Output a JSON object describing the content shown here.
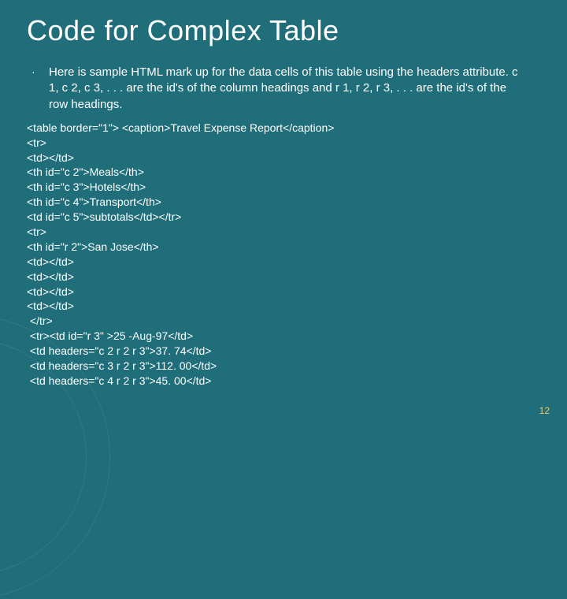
{
  "title": "Code for Complex Table",
  "bullet": {
    "marker": "·",
    "text": "Here is sample HTML mark up for the data cells of this table using the headers attribute. c 1, c 2, c 3, . . . are the id's of the column headings and r 1, r 2, r 3, . . . are the id's of the row headings."
  },
  "code_lines": [
    "<table border=\"1\"> <caption>Travel Expense Report</caption>",
    "<tr>",
    "<td></td>",
    "<th id=\"c 2\">Meals</th>",
    "<th id=\"c 3\">Hotels</th>",
    "<th id=\"c 4\">Transport</th>",
    "<td id=\"c 5\">subtotals</td></tr>",
    "<tr>",
    "<th id=\"r 2\">San Jose</th>",
    "<td></td>",
    "<td></td>",
    "<td></td>",
    "<td></td>",
    " </tr>",
    " <tr><td id=\"r 3\" >25 -Aug-97</td>",
    " <td headers=\"c 2 r 2 r 3\">37. 74</td>",
    " <td headers=\"c 3 r 2 r 3\">112. 00</td>",
    " <td headers=\"c 4 r 2 r 3\">45. 00</td>"
  ],
  "page_number": "12"
}
